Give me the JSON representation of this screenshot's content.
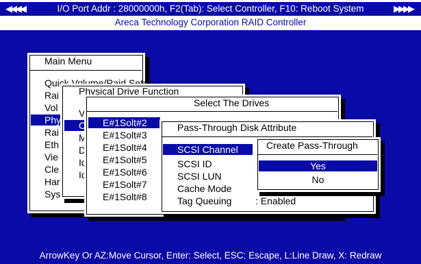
{
  "header": {
    "line1": "I/O Port Addr : 28000000h, F2(Tab): Select Controller, F10: Reboot System",
    "line2": "Areca Technology Corporation RAID Controller",
    "arrows_left": "◀◀◀◀",
    "arrows_right": "▶▶▶▶"
  },
  "main_menu": {
    "title": "Main Menu",
    "items": [
      "Quick Volume/Raid Setup",
      "Rai",
      "Vol",
      "Phy",
      "Rai",
      "Eth",
      "Vie",
      "Cle",
      "Hardwa",
      "System i"
    ]
  },
  "physical_drive": {
    "title": "Physical Drive Function",
    "items": [
      "V",
      "C",
      "M",
      "D",
      "Id",
      "Id"
    ]
  },
  "select_drives": {
    "title": "Select The Drives",
    "items": [
      "E#1Solt#2",
      "E#1Solt#3",
      "E#1Solt#4",
      "E#1Solt#5",
      "E#1Solt#6",
      "E#1Solt#7",
      "E#1Solt#8"
    ]
  },
  "passthrough": {
    "title": "Pass-Through Disk Attribute",
    "items": [
      "SCSI Channel",
      "SCSI ID",
      "SCSI LUN",
      "Cache Mode",
      "Tag Queuing"
    ],
    "tag_value": ": Enabled"
  },
  "create": {
    "title": "Create Pass-Through",
    "yes": "Yes",
    "no": "No"
  },
  "footer": "ArrowKey Or AZ:Move Cursor, Enter: Select, ESC: Escape, L:Line Draw, X: Redraw"
}
